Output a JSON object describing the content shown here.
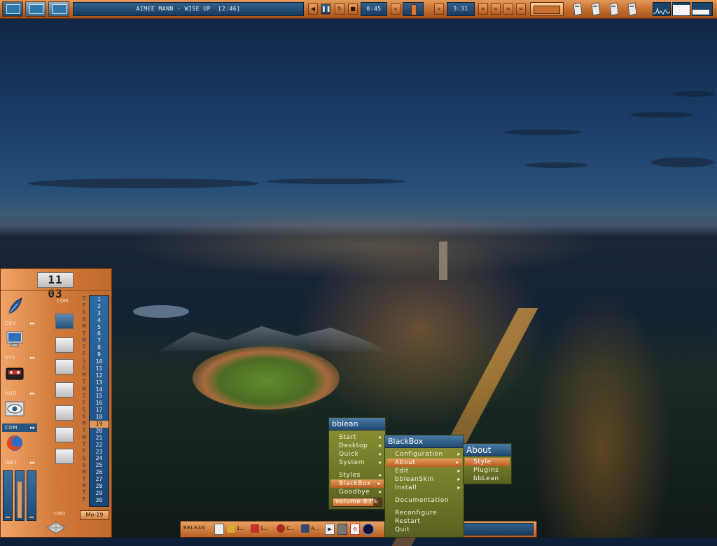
{
  "toolbar": {
    "workspaces": [
      "workspace-1",
      "workspace-2",
      "workspace-3"
    ],
    "now_playing": "AIMEE MANN - WISE UP  [2:46]",
    "player_buttons": [
      "prev",
      "pause",
      "repeat",
      "stop"
    ],
    "elapsed": "0:45",
    "total": "3:31",
    "seek_buttons": [
      "rewind",
      "forward"
    ],
    "extra_buttons": [
      "shuffle",
      "eq",
      "pl",
      "open"
    ],
    "icons": [
      "drive-icon",
      "drive-icon",
      "drive-icon",
      "drive-icon"
    ],
    "graphs": [
      "cpu-graph",
      "memory-graph",
      "network-graph"
    ]
  },
  "slit": {
    "clock": "11 03",
    "launchers": [
      {
        "label": "DEV",
        "icon": "feather-icon"
      },
      {
        "label": "SYS",
        "icon": "computer-icon"
      },
      {
        "label": "AUD",
        "icon": "cassette-icon"
      },
      {
        "label": "COM",
        "icon": "eye-icon"
      },
      {
        "label": "INET",
        "icon": "firefox-icon"
      }
    ],
    "com_label": "COM",
    "cmd_label": "CMD",
    "weekdays": [
      "T",
      "F",
      "S",
      "S",
      "M",
      "T",
      "W",
      "T",
      "F",
      "S",
      "S",
      "M",
      "T",
      "W",
      "T",
      "F",
      "S",
      "S",
      "M",
      "T",
      "W",
      "T",
      "F",
      "S",
      "S",
      "M",
      "T",
      "W",
      "T",
      "F"
    ],
    "days": [
      "1",
      "2",
      "3",
      "4",
      "5",
      "6",
      "7",
      "8",
      "9",
      "10",
      "11",
      "12",
      "13",
      "14",
      "15",
      "16",
      "17",
      "18",
      "19",
      "20",
      "21",
      "22",
      "23",
      "24",
      "25",
      "26",
      "27",
      "28",
      "29",
      "30"
    ],
    "today": "19",
    "date": "Mo-19"
  },
  "taskbar": {
    "brand": "BBLEAN",
    "tasks": [
      "1...",
      "S...",
      "C...",
      "A..."
    ]
  },
  "menus": {
    "bblean": {
      "title": "bblean",
      "items": [
        "Start",
        "Desktop",
        "Quick",
        "System",
        "Styles",
        "BlackBox",
        "Goodbye"
      ],
      "volume": "volume 83%",
      "volume_value": 0.83
    },
    "blackbox": {
      "title": "BlackBox",
      "items": [
        "Configuration",
        "About",
        "Edit",
        "bbleanSkin",
        "Install",
        "Documentation",
        "Reconfigure",
        "Restart",
        "Quit"
      ]
    },
    "about": {
      "title": "About",
      "items": [
        "Style",
        "Plugins",
        "bbLean"
      ]
    }
  }
}
